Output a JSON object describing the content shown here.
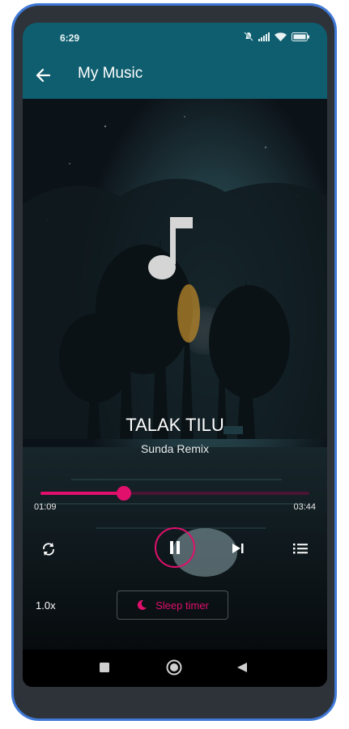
{
  "status_bar": {
    "time": "6:29",
    "icons": [
      "mute-icon",
      "signal-icon",
      "wifi-icon",
      "battery-icon"
    ]
  },
  "app_bar": {
    "title": "My Music",
    "back_icon": "arrow-back-icon"
  },
  "now_playing": {
    "title": "TALAK TILU",
    "artist": "Sunda Remix"
  },
  "progress": {
    "current": "01:09",
    "total": "03:44",
    "fraction": 0.31
  },
  "controls": {
    "repeat_icon": "repeat-icon",
    "play_state_icon": "pause-icon",
    "next_icon": "skip-next-icon",
    "queue_icon": "queue-list-icon",
    "speed": "1.0x",
    "sleep_timer_label": "Sleep timer"
  },
  "colors": {
    "accent": "#e0106c",
    "app_bar": "#0f5e6f",
    "device_frame": "#3f78d6"
  }
}
